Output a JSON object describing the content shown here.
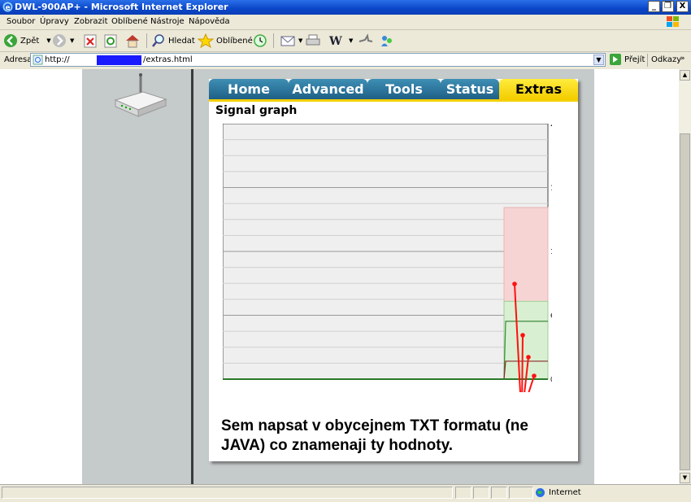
{
  "window": {
    "title": "DWL-900AP+ - Microsoft Internet Explorer",
    "minimize_label": "_",
    "maximize_label": "Ɖ",
    "close_label": "X"
  },
  "menu": [
    "Soubor",
    "Úpravy",
    "Zobrazit",
    "Oblíbené",
    "Nástroje",
    "Nápověda"
  ],
  "toolbar": {
    "back_label": "Zpět",
    "search_label": "Hledat",
    "favorites_label": "Oblíbené"
  },
  "address": {
    "label": "Adresa",
    "url_prefix": "http://",
    "url_suffix": "/extras.html",
    "go_label": "Přejít",
    "links_label": "Odkazy"
  },
  "page": {
    "tabs": [
      "Home",
      "Advanced",
      "Tools",
      "Status",
      "Extras"
    ],
    "active_tab": "Extras",
    "section_title": "Signal graph",
    "note": "Sem napsat v obycejnem TXT formatu (ne JAVA) co znamenaji ty hodnoty."
  },
  "chart_data": {
    "type": "area",
    "y_ticks": [
      "256",
      "192",
      "128",
      "64",
      "0"
    ],
    "ylim": [
      0,
      256
    ],
    "bands": [
      {
        "name": "pink",
        "color": "#f6d4d4",
        "value": 172
      },
      {
        "name": "green",
        "color": "#d9efd2",
        "value": 78
      },
      {
        "name": "dark-green-line",
        "color": "#3d8a3d",
        "value": 58
      },
      {
        "name": "dark-red-line",
        "color": "#8b2a2a",
        "value": 18
      }
    ],
    "annotation_color": "#ff1111"
  },
  "statusbar": {
    "zone": "Internet"
  }
}
